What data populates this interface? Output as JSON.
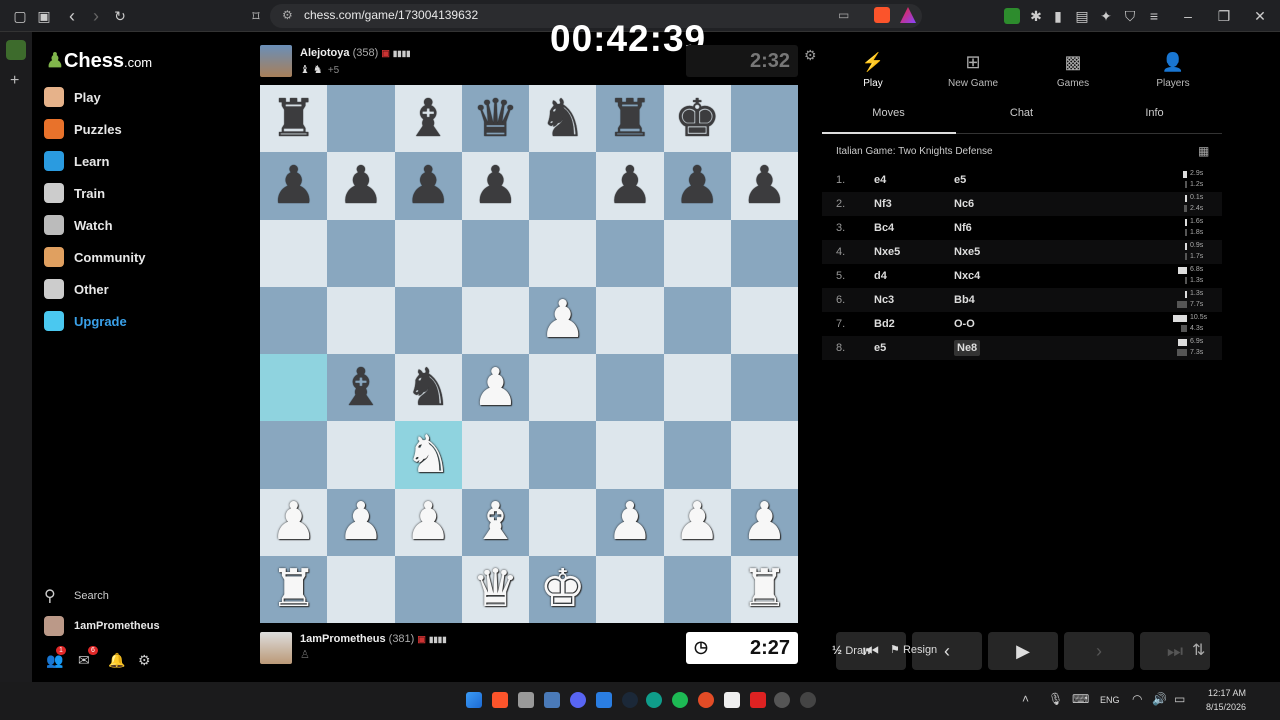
{
  "browser": {
    "url": "chess.com/game/173004139632",
    "icons": [
      "sidebar-toggle-icon",
      "tab-icon",
      "back-icon",
      "forward-icon",
      "reload-icon",
      "bookmark-icon",
      "site-info-icon",
      "cast-icon",
      "brave-shield-icon",
      "rewards-icon",
      "extension-icon",
      "puzzle-icon",
      "sidebar-icon",
      "wallet-icon",
      "leo-icon",
      "vpn-icon",
      "menu-icon",
      "minimize-icon",
      "maximize-icon",
      "close-icon"
    ]
  },
  "overlay": {
    "elapsed": "00:42:39"
  },
  "sidebar": {
    "logo": "Chess",
    "logo_suffix": ".com",
    "nav": [
      {
        "label": "Play",
        "icon": "play-pawn-icon",
        "color": "#e6b28a"
      },
      {
        "label": "Puzzles",
        "icon": "puzzle-icon",
        "color": "#e8722b"
      },
      {
        "label": "Learn",
        "icon": "graduation-cap-icon",
        "color": "#2a9be0"
      },
      {
        "label": "Train",
        "icon": "train-target-icon",
        "color": "#cccccc"
      },
      {
        "label": "Watch",
        "icon": "binoculars-icon",
        "color": "#bbbbbb"
      },
      {
        "label": "Community",
        "icon": "people-icon",
        "color": "#e0a060"
      },
      {
        "label": "Other",
        "icon": "more-icon",
        "color": "#cccccc"
      },
      {
        "label": "Upgrade",
        "icon": "diamond-icon",
        "color": "#4ac8f0"
      }
    ],
    "search_label": "Search",
    "username": "1amPrometheus",
    "badges": {
      "friends": "1",
      "messages": "6"
    }
  },
  "top_player": {
    "name": "Alejotoya",
    "rating": "(358)",
    "captured": "♝ ♞",
    "advantage": "+5",
    "clock": "2:32"
  },
  "bottom_player": {
    "name": "1amPrometheus",
    "rating": "(381)",
    "captured": "♙",
    "clock": "2:27"
  },
  "board": [
    [
      "r",
      "",
      "b",
      "q",
      "n",
      "r",
      "k",
      ""
    ],
    [
      "p",
      "p",
      "p",
      "p",
      "",
      "p",
      "p",
      "p"
    ],
    [
      "",
      "",
      "",
      "",
      "",
      "",
      "",
      ""
    ],
    [
      "",
      "",
      "",
      "",
      "P",
      "",
      "",
      ""
    ],
    [
      "",
      "b",
      "n",
      "P",
      "",
      "",
      "",
      ""
    ],
    [
      "",
      "",
      "N",
      "",
      "",
      "",
      "",
      ""
    ],
    [
      "P",
      "P",
      "P",
      "B",
      "",
      "P",
      "P",
      "P"
    ],
    [
      "R",
      "",
      "",
      "Q",
      "K",
      "",
      "",
      "R"
    ]
  ],
  "highlights": [
    "4-0",
    "5-2"
  ],
  "panel": {
    "topnav": [
      {
        "label": "Play",
        "icon": "lightning-icon"
      },
      {
        "label": "New Game",
        "icon": "plus-icon"
      },
      {
        "label": "Games",
        "icon": "board-icon"
      },
      {
        "label": "Players",
        "icon": "players-icon"
      }
    ],
    "tabs": [
      "Moves",
      "Chat",
      "Info"
    ],
    "opening": "Italian Game: Two Knights Defense",
    "moves": [
      {
        "n": "1.",
        "w": "e4",
        "b": "e5",
        "tw": "2.9s",
        "tb": "1.2s",
        "fw": 0.28,
        "fb": 0.11
      },
      {
        "n": "2.",
        "w": "Nf3",
        "b": "Nc6",
        "tw": "0.1s",
        "tb": "2.4s",
        "fw": 0.01,
        "fb": 0.23
      },
      {
        "n": "3.",
        "w": "Bc4",
        "b": "Nf6",
        "tw": "1.6s",
        "tb": "1.8s",
        "fw": 0.15,
        "fb": 0.17
      },
      {
        "n": "4.",
        "w": "Nxe5",
        "b": "Nxe5",
        "tw": "0.9s",
        "tb": "1.7s",
        "fw": 0.09,
        "fb": 0.16
      },
      {
        "n": "5.",
        "w": "d4",
        "b": "Nxc4",
        "tw": "6.8s",
        "tb": "1.3s",
        "fw": 0.65,
        "fb": 0.12
      },
      {
        "n": "6.",
        "w": "Nc3",
        "b": "Bb4",
        "tw": "1.3s",
        "tb": "7.7s",
        "fw": 0.12,
        "fb": 0.73
      },
      {
        "n": "7.",
        "w": "Bd2",
        "b": "O-O",
        "tw": "10.5s",
        "tb": "4.3s",
        "fw": 1.0,
        "fb": 0.41
      },
      {
        "n": "8.",
        "w": "e5",
        "b": "Ne8",
        "tw": "6.9s",
        "tb": "7.3s",
        "fw": 0.66,
        "fb": 0.7
      }
    ],
    "controls": [
      "⏮",
      "‹",
      "▶",
      "›",
      "⏭"
    ],
    "draw_label": "Draw",
    "draw_prefix": "½",
    "resign_label": "Resign"
  },
  "taskbar": {
    "lang": "ENG",
    "time": "12:17 AM",
    "date": "8/15/2026"
  }
}
